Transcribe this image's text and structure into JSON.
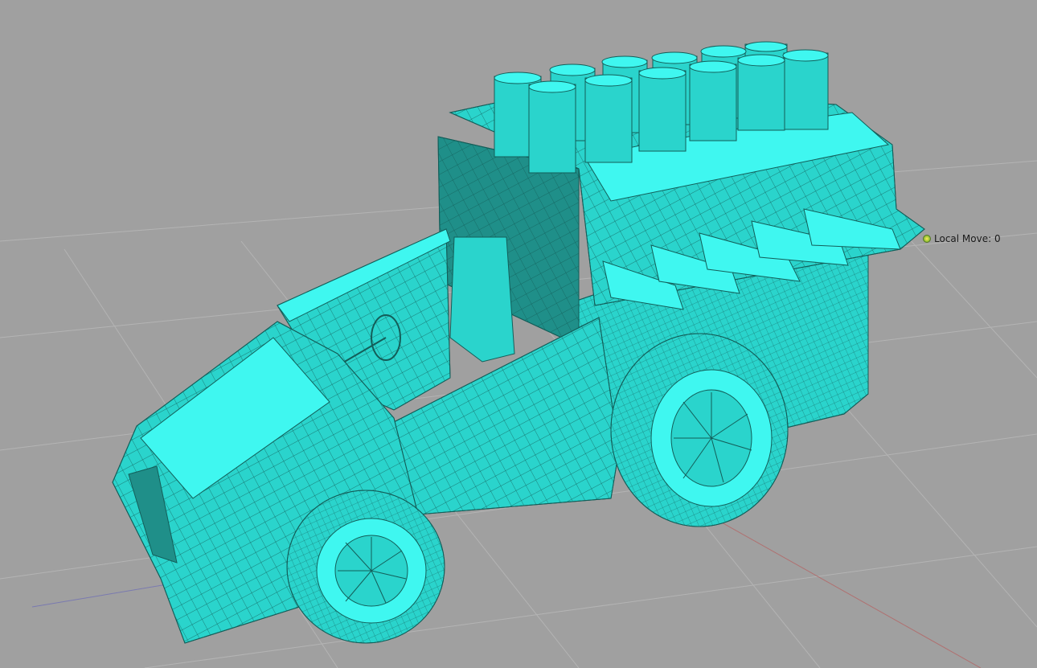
{
  "viewport": {
    "background_color": "#a0a0a0",
    "grid_color": "#b4b4b4",
    "axis_x_color": "#b07070",
    "axis_z_color": "#7a7ab0"
  },
  "model": {
    "name_icon": "car-model-icon",
    "base_color": "#2ad4cc",
    "highlight_color": "#3ff7f0",
    "shadow_color": "#1f8f89",
    "wire_color": "#135e59"
  },
  "transform_readout": {
    "label": "Local Move: 0",
    "gizmo_icon": "move-gizmo-icon",
    "gizmo_color": "#d6e04a"
  }
}
